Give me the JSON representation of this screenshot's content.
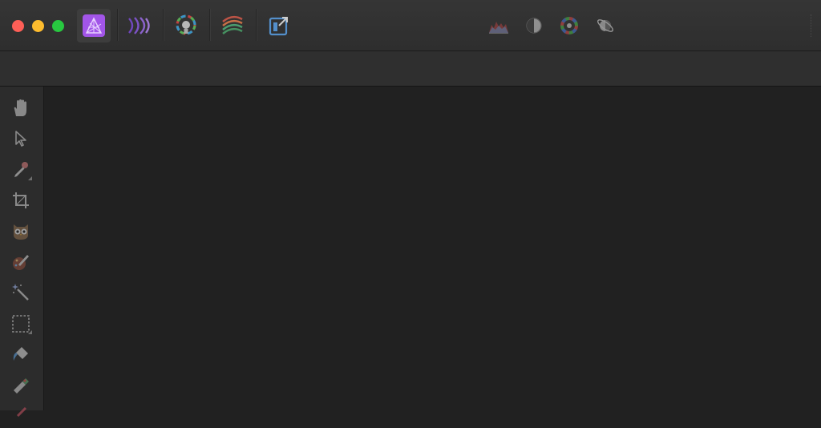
{
  "window": {
    "controls": [
      "close",
      "minimize",
      "maximize"
    ]
  },
  "personas": [
    {
      "name": "photo-persona",
      "icon": "affinity-photo-icon",
      "active": true
    },
    {
      "name": "liquify-persona",
      "icon": "liquify-icon",
      "active": false
    },
    {
      "name": "develop-persona",
      "icon": "develop-icon",
      "active": false
    },
    {
      "name": "tone-mapping-persona",
      "icon": "tone-mapping-icon",
      "active": false
    },
    {
      "name": "export-persona",
      "icon": "export-icon",
      "active": false
    }
  ],
  "studio": [
    {
      "name": "histogram",
      "icon": "histogram-icon"
    },
    {
      "name": "auto-contrast",
      "icon": "contrast-icon"
    },
    {
      "name": "auto-colour",
      "icon": "color-wheel-icon"
    },
    {
      "name": "auto-white-balance",
      "icon": "white-balance-icon"
    }
  ],
  "tools": [
    {
      "name": "view-tool",
      "icon": "hand-icon"
    },
    {
      "name": "move-tool",
      "icon": "pointer-arrow-icon"
    },
    {
      "name": "color-picker-tool",
      "icon": "eyedropper-icon",
      "flyout": true
    },
    {
      "name": "crop-tool",
      "icon": "crop-icon"
    },
    {
      "name": "selection-brush-tool",
      "icon": "owl-icon"
    },
    {
      "name": "paint-brush-tool",
      "icon": "paint-brush-icon"
    },
    {
      "name": "flood-select-tool",
      "icon": "magic-wand-icon"
    },
    {
      "name": "marquee-tool",
      "icon": "rectangle-marquee-icon",
      "flyout": true
    },
    {
      "name": "flood-fill-tool",
      "icon": "paint-bucket-icon"
    },
    {
      "name": "clone-tool",
      "icon": "clone-stamp-icon"
    }
  ],
  "colors": {
    "photo_purple": "#a255e8",
    "titlebar": "#323232",
    "canvas": "#212121"
  }
}
